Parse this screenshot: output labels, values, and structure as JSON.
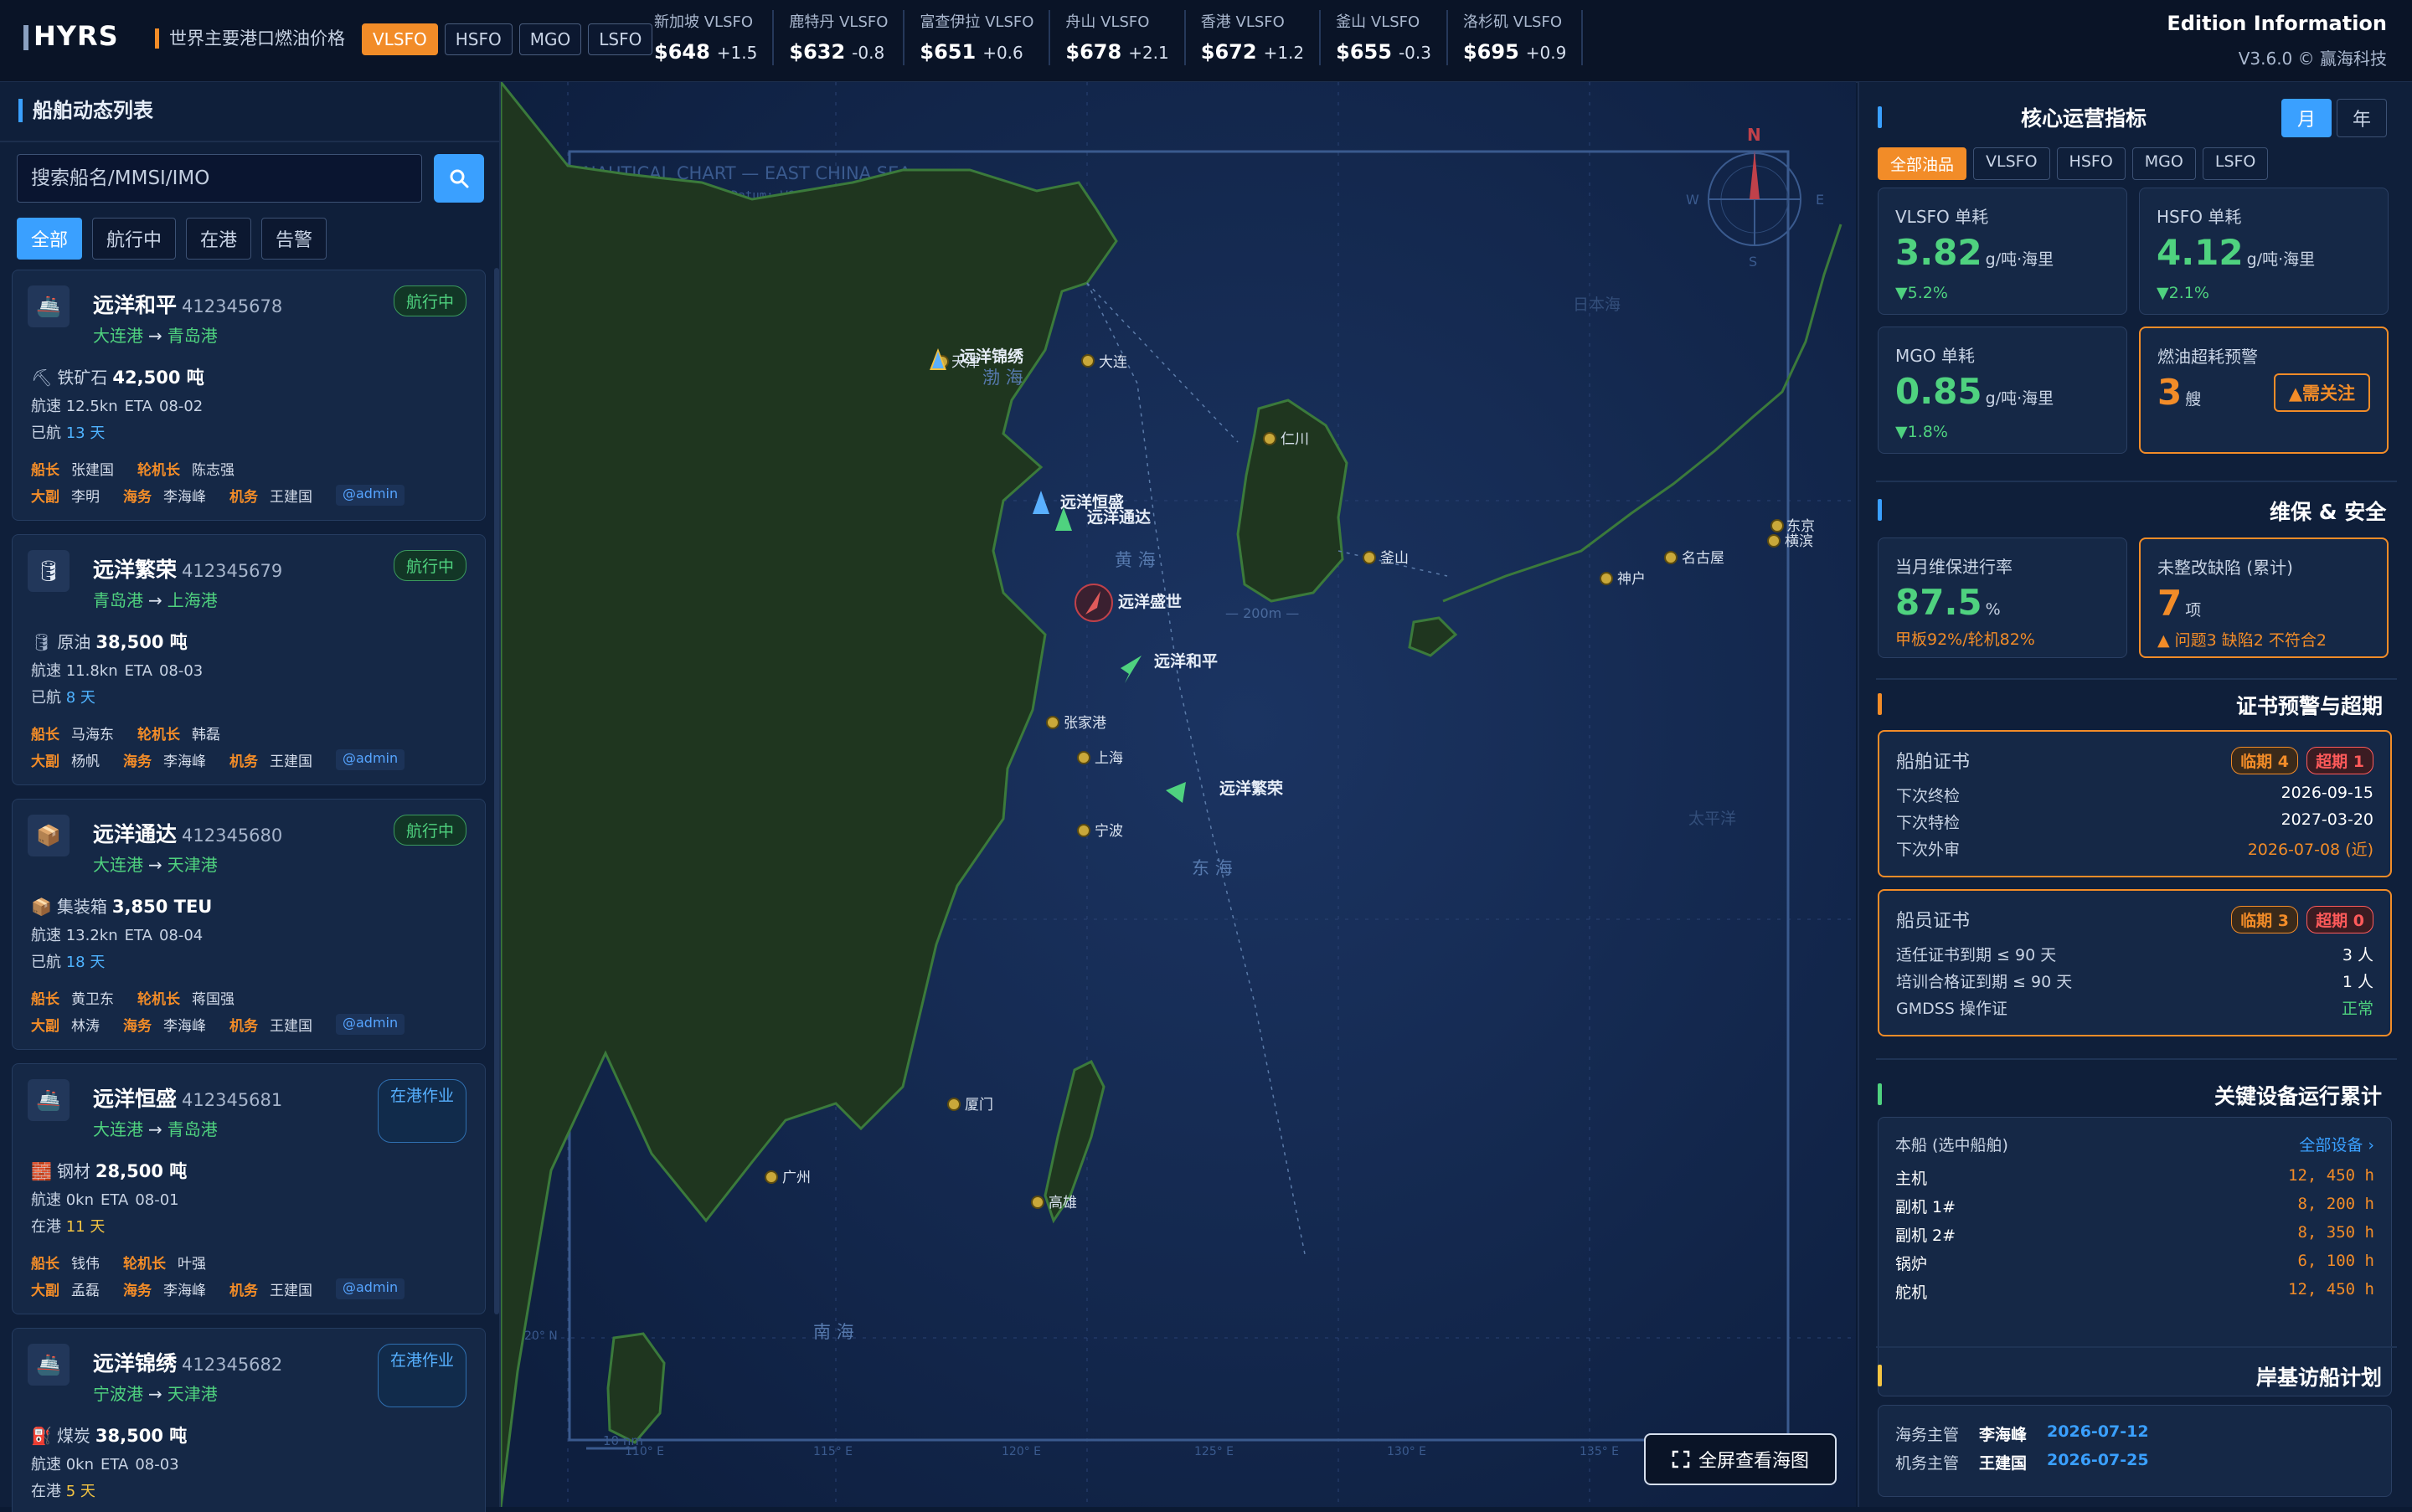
{
  "header": {
    "logo_text": "HYRS",
    "price_title": "世界主要港口燃油价格",
    "fuel_tabs": [
      "VLSFO",
      "HSFO",
      "MGO",
      "LSFO"
    ],
    "ports": [
      {
        "name": "新加坡 VLSFO",
        "price": "$648",
        "change": "+1.5"
      },
      {
        "name": "鹿特丹 VLSFO",
        "price": "$632",
        "change": "-0.8"
      },
      {
        "name": "富查伊拉 VLSFO",
        "price": "$651",
        "change": "+0.6"
      },
      {
        "name": "舟山 VLSFO",
        "price": "$678",
        "change": "+2.1"
      },
      {
        "name": "香港 VLSFO",
        "price": "$672",
        "change": "+1.2"
      },
      {
        "name": "釜山 VLSFO",
        "price": "$655",
        "change": "-0.3"
      },
      {
        "name": "洛杉矶 VLSFO",
        "price": "$695",
        "change": "+0.9"
      }
    ],
    "edition_title": "Edition Information",
    "edition_version": "V3.6.0 © 赢海科技"
  },
  "left": {
    "title": "船舶动态列表",
    "search_placeholder": "搜索船名/MMSI/IMO",
    "filters": [
      "全部",
      "航行中",
      "在港",
      "告警"
    ],
    "ships": [
      {
        "name": "远洋和平",
        "mmsi": "412345678",
        "from": "大连港",
        "to": "青岛港",
        "status": "航行中",
        "icon": "🚢",
        "cargo_icon": "⛏",
        "cargo": "铁矿石",
        "amount": "42,500 吨",
        "speed": "航速 12.5kn",
        "eta": "ETA",
        "eta_date": "08-02",
        "days_label": "已航",
        "days_value": "13 天",
        "captain_role": "船长",
        "captain": "张建国",
        "chief_eng_role": "轮机长",
        "chief_eng": "陈志强",
        "mate_role": "大副",
        "mate": "李明",
        "marine_role": "海务",
        "marine": "李海峰",
        "mech_role": "机务",
        "mech": "王建国",
        "admin": "@admin"
      },
      {
        "name": "远洋繁荣",
        "mmsi": "412345679",
        "from": "青岛港",
        "to": "上海港",
        "status": "航行中",
        "icon": "🛢",
        "cargo_icon": "🛢",
        "cargo": "原油",
        "amount": "38,500 吨",
        "speed": "航速 11.8kn",
        "eta": "ETA",
        "eta_date": "08-03",
        "days_label": "已航",
        "days_value": "8 天",
        "captain_role": "船长",
        "captain": "马海东",
        "chief_eng_role": "轮机长",
        "chief_eng": "韩磊",
        "mate_role": "大副",
        "mate": "杨帆",
        "marine_role": "海务",
        "marine": "李海峰",
        "mech_role": "机务",
        "mech": "王建国",
        "admin": "@admin"
      },
      {
        "name": "远洋通达",
        "mmsi": "412345680",
        "from": "大连港",
        "to": "天津港",
        "status": "航行中",
        "icon": "📦",
        "cargo_icon": "📦",
        "cargo": "集装箱",
        "amount": "3,850 TEU",
        "speed": "航速 13.2kn",
        "eta": "ETA",
        "eta_date": "08-04",
        "days_label": "已航",
        "days_value": "18 天",
        "captain_role": "船长",
        "captain": "黄卫东",
        "chief_eng_role": "轮机长",
        "chief_eng": "蒋国强",
        "mate_role": "大副",
        "mate": "林涛",
        "marine_role": "海务",
        "marine": "李海峰",
        "mech_role": "机务",
        "mech": "王建国",
        "admin": "@admin"
      },
      {
        "name": "远洋恒盛",
        "mmsi": "412345681",
        "from": "大连港",
        "to": "青岛港",
        "status": "在港作业",
        "icon": "🚢",
        "cargo_icon": "🧱",
        "cargo": "钢材",
        "amount": "28,500 吨",
        "speed": "航速 0kn",
        "eta": "ETA",
        "eta_date": "08-01",
        "days_label": "在港",
        "days_value": "11 天",
        "captain_role": "船长",
        "captain": "钱伟",
        "chief_eng_role": "轮机长",
        "chief_eng": "叶强",
        "mate_role": "大副",
        "mate": "孟磊",
        "marine_role": "海务",
        "marine": "李海峰",
        "mech_role": "机务",
        "mech": "王建国",
        "admin": "@admin"
      },
      {
        "name": "远洋锦绣",
        "mmsi": "412345682",
        "from": "宁波港",
        "to": "天津港",
        "status": "在港作业",
        "icon": "🚢",
        "cargo_icon": "⛽",
        "cargo": "煤炭",
        "amount": "38,500 吨",
        "speed": "航速 0kn",
        "eta": "ETA",
        "eta_date": "08-03",
        "days_label": "在港",
        "days_value": "5 天"
      }
    ]
  },
  "map": {
    "chart_title": "NAUTICAL CHART — EAST CHINA SEA",
    "chart_sub": "Projection: Mercator  Datum: WGS-84  Source: ENC",
    "compass": {
      "n": "N",
      "s": "S",
      "e": "E",
      "w": "W"
    },
    "seas": [
      "渤 海",
      "黄 海",
      "东 海",
      "南 海",
      "日本海",
      "太平洋"
    ],
    "depth_label": "— 200m —",
    "ports": [
      "天津",
      "大连",
      "仁川",
      "釜山",
      "神户",
      "名古屋",
      "东京",
      "横滨",
      "张家港",
      "上海",
      "宁波",
      "厦门",
      "广州",
      "高雄"
    ],
    "ships": [
      "远洋锦绣",
      "远洋恒盛",
      "远洋通达",
      "远洋盛世",
      "远洋和平",
      "远洋繁荣"
    ],
    "lon_labels": [
      "110° E",
      "115° E",
      "120° E",
      "125° E",
      "130° E",
      "135° E"
    ],
    "lat_label": "20° N",
    "scale": "10 nm",
    "fullscreen": "全屏查看海图"
  },
  "right": {
    "kpi_title": "核心运营指标",
    "period": [
      "月",
      "年"
    ],
    "oil_tabs": [
      "全部油品",
      "VLSFO",
      "HSFO",
      "MGO",
      "LSFO"
    ],
    "kpis": [
      {
        "label": "VLSFO 单耗",
        "value": "3.82",
        "unit": "g/吨·海里",
        "sub": "▼5.2%"
      },
      {
        "label": "HSFO 单耗",
        "value": "4.12",
        "unit": "g/吨·海里",
        "sub": "▼2.1%"
      },
      {
        "label": "MGO 单耗",
        "value": "0.85",
        "unit": "g/吨·海里",
        "sub": "▼1.8%"
      }
    ],
    "overuse": {
      "label": "燃油超耗预警",
      "value": "3",
      "unit": "艘",
      "attention": "▲需关注"
    },
    "maint_title": "维保 & 安全",
    "maint_rate": {
      "label": "当月维保进行率",
      "value": "87.5",
      "unit": "%",
      "sub": "甲板92%/轮机82%"
    },
    "defects": {
      "label": "未整改缺陷 (累计)",
      "value": "7",
      "unit": "项",
      "sub": "▲ 问题3 缺陷2 不符合2"
    },
    "cert_title": "证书预警与超期",
    "ship_cert": {
      "title": "船舶证书",
      "near": "临期 4",
      "over": "超期 1",
      "rows": [
        {
          "k": "下次终检",
          "v": "2026-09-15"
        },
        {
          "k": "下次特检",
          "v": "2027-03-20"
        },
        {
          "k": "下次外审",
          "v": "2026-07-08 (近)"
        }
      ]
    },
    "crew_cert": {
      "title": "船员证书",
      "near": "临期 3",
      "over": "超期 0",
      "rows": [
        {
          "k": "适任证书到期 ≤ 90 天",
          "v": "3 人"
        },
        {
          "k": "培训合格证到期 ≤ 90 天",
          "v": "1 人"
        },
        {
          "k": "GMDSS 操作证",
          "v": "正常"
        }
      ]
    },
    "equip_title": "关键设备运行累计",
    "equip_scope": "本船 (选中船舶)",
    "equip_link": "全部设备 ›",
    "equipment": [
      {
        "name": "主机",
        "hours": "12, 450 h"
      },
      {
        "name": "副机 1#",
        "hours": "8, 200 h"
      },
      {
        "name": "副机 2#",
        "hours": "8, 350 h"
      },
      {
        "name": "锅炉",
        "hours": "6, 100 h"
      },
      {
        "name": "舵机",
        "hours": "12, 450 h"
      }
    ],
    "visit_title": "岸基访船计划",
    "visits": [
      {
        "role": "海务主管",
        "name": "李海峰",
        "date": "2026-07-12"
      },
      {
        "role": "机务主管",
        "name": "王建国",
        "date": "2026-07-25"
      }
    ]
  },
  "colors": {
    "accent": "#3aa0ff",
    "warn": "#f28c28",
    "ok": "#4fd27f",
    "danger": "#ff5a5a"
  }
}
